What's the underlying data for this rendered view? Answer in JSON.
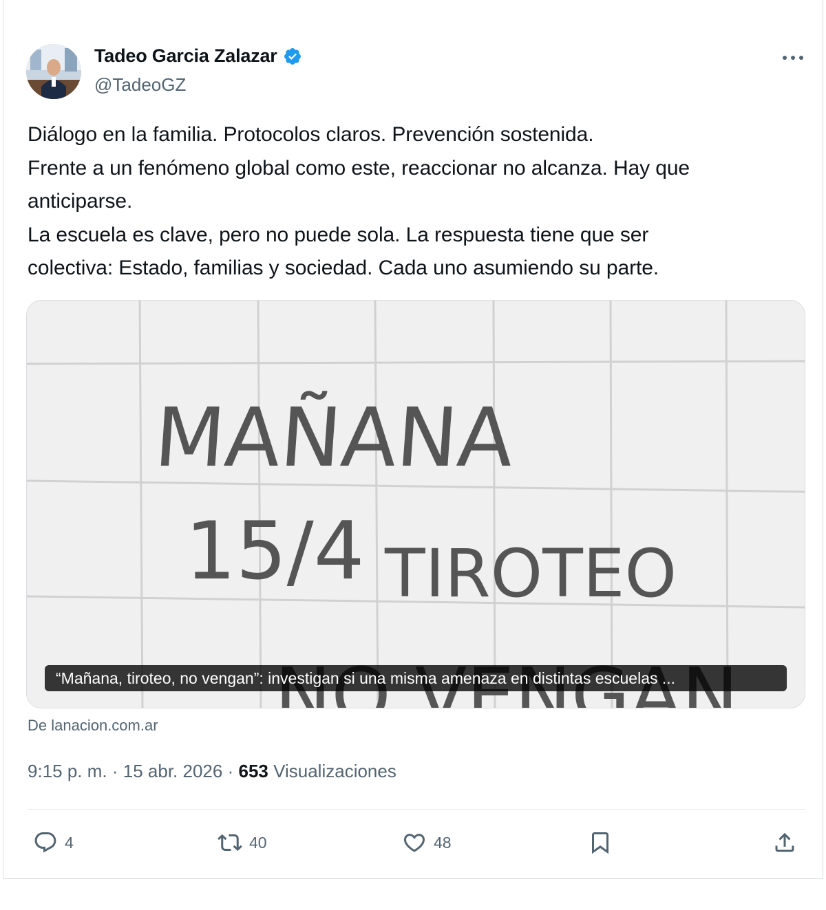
{
  "author": {
    "name": "Tadeo Garcia Zalazar",
    "handle": "@TadeoGZ",
    "verified_color": "#1d9bf0"
  },
  "more_icon": "more-horizontal-icon",
  "post": {
    "lines": [
      "Diálogo en la familia. Protocolos claros. Prevención sostenida.",
      "Frente a un fenómeno global como este, reaccionar no alcanza. Hay que",
      "anticiparse.",
      "La escuela es clave, pero no puede sola. La respuesta tiene que ser",
      "colectiva: Estado, familias y sociedad. Cada uno asumiendo su parte."
    ]
  },
  "link_card": {
    "caption": "“Mañana, tiroteo, no vengan”: investigan si una misma amenaza en distintas escuelas ...",
    "source": "De lanacion.com.ar",
    "photo_text": [
      "MAÑANA",
      "15/4",
      "TIROTEO",
      "NO VENGAN"
    ]
  },
  "meta": {
    "time": "9:15 p. m.",
    "separator": "·",
    "date": "15 abr. 2026",
    "views_count": "653",
    "views_label": "Visualizaciones"
  },
  "actions": {
    "replies": "4",
    "reposts": "40",
    "likes": "48",
    "icons": [
      "reply-icon",
      "repost-icon",
      "like-icon",
      "bookmark-icon",
      "share-icon"
    ],
    "icon_color": "#536471"
  }
}
